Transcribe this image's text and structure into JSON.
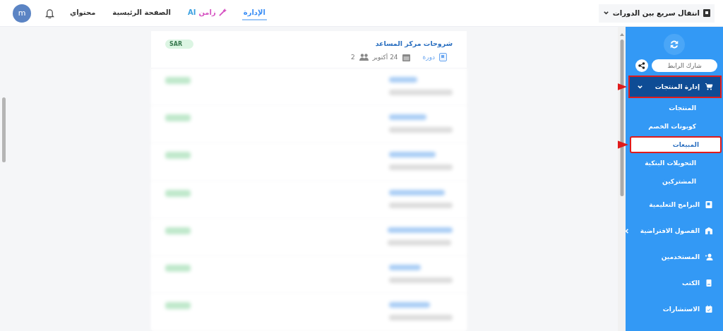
{
  "topbar": {
    "quick_switch": {
      "label": "انتقال سريع بين الدورات"
    },
    "nav": [
      {
        "kind": "link",
        "label": "الإدارة",
        "selected": true
      },
      {
        "kind": "brand",
        "label": "زامن",
        "suffix": "AI",
        "selected": false
      },
      {
        "kind": "link",
        "label": "الصفحة الرئيسية",
        "selected": false
      },
      {
        "kind": "link",
        "label": "محتواي",
        "selected": false
      }
    ],
    "avatar": {
      "initial": "m"
    }
  },
  "sidebar": {
    "share": {
      "label": "شارك الرابط"
    },
    "items": [
      {
        "kind": "products",
        "label": "إدارة المنتجات",
        "selected": true,
        "expanded": true,
        "highlighted": true,
        "children": [
          {
            "label": "المنتجات",
            "selected": false,
            "highlighted": false
          },
          {
            "label": "كوبونات الخصم",
            "selected": false,
            "highlighted": false
          },
          {
            "label": "المبيعات",
            "selected": true,
            "highlighted": true
          },
          {
            "label": "التحويلات البنكية",
            "selected": false,
            "highlighted": false
          },
          {
            "label": "المشتركين",
            "selected": false,
            "highlighted": false
          }
        ]
      },
      {
        "kind": "programs",
        "label": "البرامج التعليمية",
        "selected": false,
        "highlighted": false
      },
      {
        "kind": "classes",
        "label": "الفصول الافتراضية",
        "selected": false,
        "expanded": false,
        "highlighted": false
      },
      {
        "kind": "users",
        "label": "المستخدمين",
        "selected": false,
        "highlighted": false
      },
      {
        "kind": "books",
        "label": "الكتب",
        "selected": false,
        "highlighted": false
      },
      {
        "kind": "consult",
        "label": "الاستشارات",
        "selected": false,
        "highlighted": false
      }
    ]
  },
  "sales": {
    "first": {
      "title": "شروحات مركز المساعد",
      "type": "دورة",
      "date": "24 أكتوبر",
      "count": "2",
      "currency": "SAR"
    },
    "blurred_rows": [
      {
        "kind": "blurred"
      },
      {
        "kind": "blurred"
      },
      {
        "kind": "blurred"
      },
      {
        "kind": "blurred"
      },
      {
        "kind": "blurred"
      },
      {
        "kind": "blurred"
      },
      {
        "kind": "blurred"
      }
    ]
  }
}
